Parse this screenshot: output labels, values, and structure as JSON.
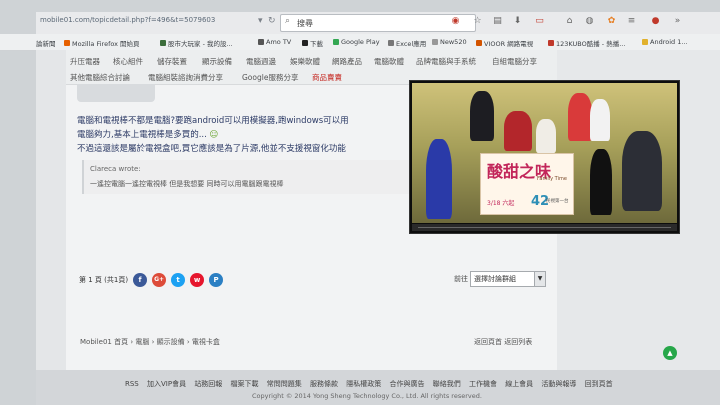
{
  "browser": {
    "url": "mobile01.com/topicdetail.php?f=496&t=5079603",
    "search_placeholder": "搜尋"
  },
  "bookmarks": [
    "論新聞",
    "Mozilla Firefox 開始頁",
    "股市大玩家 - 我的設...",
    "Amo TV",
    "下載",
    "Google Play",
    "Excel應用",
    "New520",
    "VIOOR 網路電視",
    "123KUBO酷播 - 熱播...",
    "Android 1..."
  ],
  "forum_nav": {
    "row1": [
      "升压電器",
      "核心組件",
      "儲存裝置",
      "顯示設備",
      "電腦週邊",
      "娛樂軟體",
      "網路產品",
      "電腦軟體",
      "品牌電腦與手系統",
      "自組電腦分享"
    ],
    "row2": [
      "其他電腦綜合討論",
      "電腦組裝諮詢消費分享",
      "Google服務分享",
      "商品賣賣"
    ]
  },
  "post": {
    "line1": "電腦和電視棒不都是電腦?要跑android可以用模擬器,跑windows可以用",
    "line2": "電腦夠力,基本上電視棒是多買的...",
    "line3": "不過這還該是屬於電視盒吧,買它應該是為了片源,他並不支援視窗化功能",
    "quote_author": "Clareca wrote:",
    "quote_text": "一遙控電腦一遙控電視棒 但是我想要 同時可以用電腦跟電視棒"
  },
  "pager": {
    "label": "第 1 頁 (共1頁)",
    "goto_label": "前往",
    "select_value": "選擇討論群組"
  },
  "social": [
    "f",
    "G+",
    "t",
    "w",
    "P"
  ],
  "breadcrumb": "Mobile01 首頁 › 電腦 › 顯示設備 › 電視卡盒",
  "breadcrumb_right": "返回頁首  返回列表",
  "footer": {
    "links": [
      "RSS",
      "加入VIP會員",
      "站務回報",
      "檔案下載",
      "常問問題集",
      "服務條款",
      "隱私權政策",
      "合作與廣告",
      "聯絡我們",
      "工作機會",
      "線上會員",
      "活動與報導",
      "回到頁首"
    ],
    "copyright": "Copyright © 2014 Yong Sheng Technology Co., Ltd. All rights reserved."
  },
  "video": {
    "title": "酸甜之味",
    "subtitle": "Family Time",
    "date": "3/18 六起",
    "channel": "42",
    "channel_sub": "民視第一台"
  },
  "colors": {
    "accent_red": "#c4221b",
    "facebook": "#3b5998",
    "gplus": "#dd4b39",
    "twitter": "#1da1f2",
    "weibo": "#e6162d",
    "totop": "#27a74a"
  }
}
